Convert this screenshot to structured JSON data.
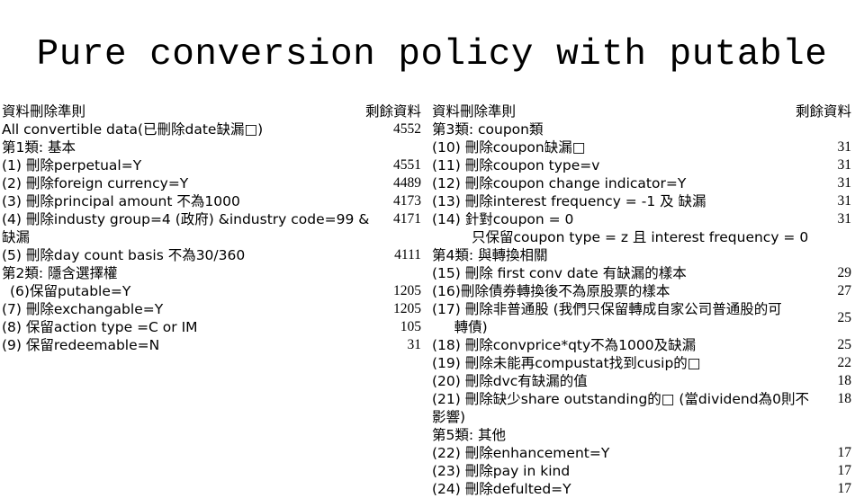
{
  "title": "Pure conversion policy with putable",
  "left_column": {
    "header": {
      "criteria": "資料刪除準則",
      "remaining": "剩餘資料"
    },
    "rows": [
      {
        "label": "All convertible data(已刪除date缺漏□)",
        "value": "4552",
        "indent": 0
      },
      {
        "label": "第1類: 基本",
        "value": "",
        "indent": 0
      },
      {
        "label": "(1) 刪除perpetual=Y",
        "value": "4551",
        "indent": 0
      },
      {
        "label": "(2) 刪除foreign currency=Y",
        "value": "4489",
        "indent": 0
      },
      {
        "label": "(3) 刪除principal amount 不為1000",
        "value": "4173",
        "indent": 0
      },
      {
        "label": "(4) 刪除industy group=4 (政府) &industry code=99 & 缺漏",
        "value": "4171",
        "indent": 0
      },
      {
        "label": "(5) 刪除day count basis 不為30/360",
        "value": "4111",
        "indent": 0
      },
      {
        "label": "第2類: 隱含選擇權",
        "value": "",
        "indent": 0
      },
      {
        "label": "(6)保留putable=Y",
        "value": "1205",
        "indent": 1
      },
      {
        "label": "(7) 刪除exchangable=Y",
        "value": "1205",
        "indent": 0
      },
      {
        "label": "(8) 保留action type =C or IM",
        "value": "105",
        "indent": 0
      },
      {
        "label": "(9) 保留redeemable=N",
        "value": "31",
        "indent": 0
      }
    ]
  },
  "right_column": {
    "header": {
      "criteria": "資料刪除準則",
      "remaining": "剩餘資料"
    },
    "rows": [
      {
        "label": "第3類: coupon類",
        "value": "",
        "indent": 0
      },
      {
        "label": "(10) 刪除coupon缺漏□",
        "value": "31",
        "indent": 0
      },
      {
        "label": "(11) 刪除coupon type=v",
        "value": "31",
        "indent": 0
      },
      {
        "label": "(12) 刪除coupon change indicator=Y",
        "value": "31",
        "indent": 0
      },
      {
        "label": "(13) 刪除interest frequency = -1 及 缺漏",
        "value": "31",
        "indent": 0
      },
      {
        "label": "(14) 針對coupon = 0",
        "value": "31",
        "indent": 0
      },
      {
        "label": "只保留coupon type = z 且 interest frequency = 0",
        "value": "",
        "indent": 2
      },
      {
        "label": "第4類: 與轉換相關",
        "value": "",
        "indent": 0
      },
      {
        "label": "(15) 刪除 first conv date 有缺漏的樣本",
        "value": "29",
        "indent": 0
      },
      {
        "label": "(16)刪除債券轉換後不為原股票的樣本",
        "value": "27",
        "indent": 0
      },
      {
        "label": "(17) 刪除非普通股 (我們只保留轉成自家公司普通股的可\n     轉債)",
        "value": "25",
        "indent": 0,
        "wrap": true
      },
      {
        "label": "(18) 刪除convprice*qty不為1000及缺漏",
        "value": "25",
        "indent": 0
      },
      {
        "label": "(19) 刪除未能再compustat找到cusip的□",
        "value": "22",
        "indent": 0
      },
      {
        "label": "(20) 刪除dvc有缺漏的值",
        "value": "18",
        "indent": 0
      },
      {
        "label": "(21) 刪除缺少share outstanding的□ (當dividend為0則不影響)",
        "value": "18",
        "indent": 0
      },
      {
        "label": "第5類: 其他",
        "value": "",
        "indent": 0
      },
      {
        "label": "(22) 刪除enhancement=Y",
        "value": "17",
        "indent": 0
      },
      {
        "label": "(23) 刪除pay in kind",
        "value": "17",
        "indent": 0
      },
      {
        "label": "(24) 刪除defulted=Y",
        "value": "17",
        "indent": 0
      }
    ]
  }
}
